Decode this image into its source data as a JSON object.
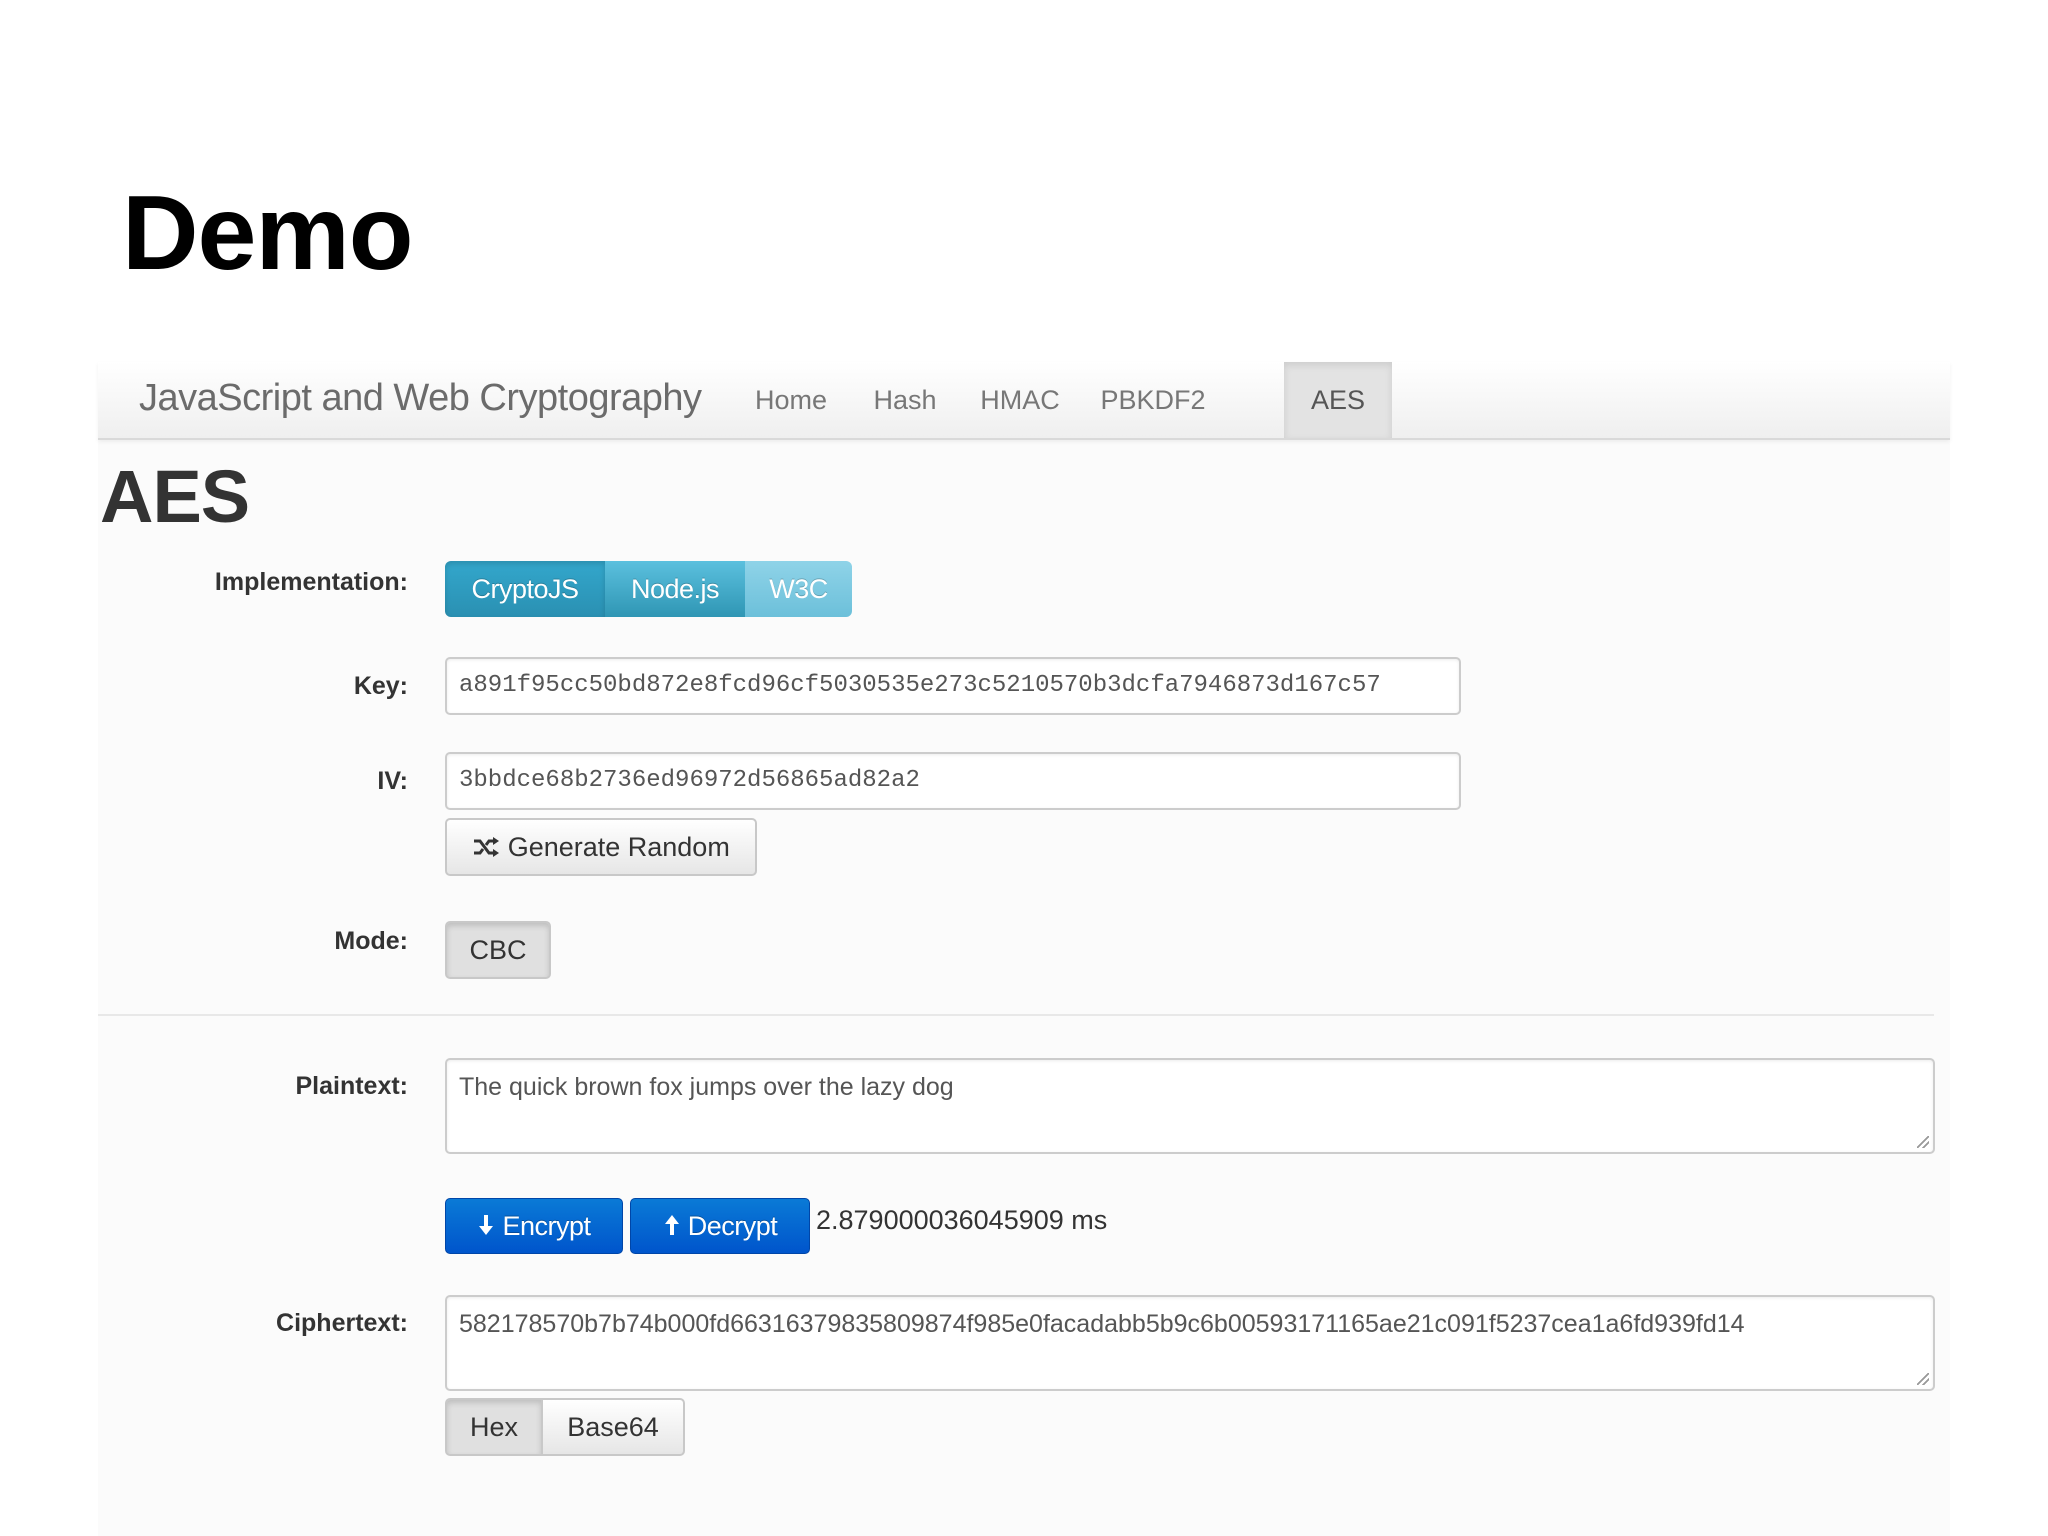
{
  "slide": {
    "title": "Demo"
  },
  "navbar": {
    "brand": "JavaScript and Web Cryptography",
    "items": [
      {
        "label": "Home"
      },
      {
        "label": "Hash"
      },
      {
        "label": "HMAC"
      },
      {
        "label": "PBKDF2"
      },
      {
        "label": "AES",
        "active": true
      }
    ]
  },
  "page": {
    "heading": "AES"
  },
  "form": {
    "implementation": {
      "label": "Implementation:",
      "options": [
        "CryptoJS",
        "Node.js",
        "W3C"
      ],
      "selected": "CryptoJS"
    },
    "key": {
      "label": "Key:",
      "value": "a891f95cc50bd872e8fcd96cf5030535e273c5210570b3dcfa7946873d167c57"
    },
    "iv": {
      "label": "IV:",
      "value": "3bbdce68b2736ed96972d56865ad82a2"
    },
    "generate_random": {
      "label": "Generate Random",
      "icon": "shuffle-icon"
    },
    "mode": {
      "label": "Mode:",
      "value": "CBC"
    },
    "plaintext": {
      "label": "Plaintext:",
      "value": "The quick brown fox jumps over the lazy dog"
    },
    "actions": {
      "encrypt": {
        "label": "Encrypt",
        "icon": "arrow-down-icon"
      },
      "decrypt": {
        "label": "Decrypt",
        "icon": "arrow-up-icon"
      },
      "timing": "2.879000036045909 ms"
    },
    "ciphertext": {
      "label": "Ciphertext:",
      "value": "582178570b7b74b000fd66316379835809874f985e0facadabb5b9c6b00593171165ae21c091f5237cea1a6fd939fd14",
      "encodings": [
        "Hex",
        "Base64"
      ],
      "selected_encoding": "Hex"
    }
  },
  "colors": {
    "primary": "#0a64d2",
    "info": "#2f96b4",
    "text": "#333333"
  }
}
